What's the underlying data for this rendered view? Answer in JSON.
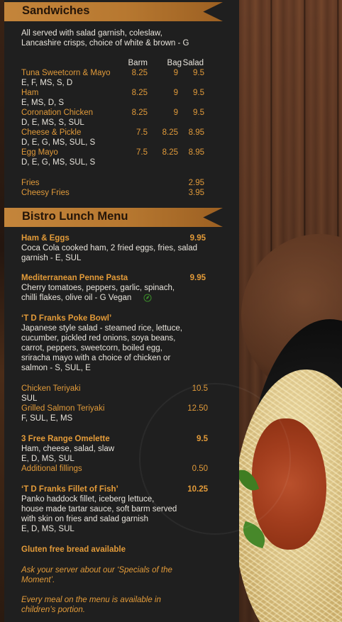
{
  "sandwiches": {
    "title": "Sandwiches",
    "intro": [
      "All served with salad garnish, coleslaw,",
      "Lancashire crisps, choice of white & brown - G"
    ],
    "columns": [
      "Barm",
      "Bag",
      "Salad"
    ],
    "items": [
      {
        "name": "Tuna Sweetcorn & Mayo",
        "barm": "8.25",
        "bag": "9",
        "salad": "9.5",
        "allergens": "E, F, MS, S, D"
      },
      {
        "name": "Ham",
        "barm": "8.25",
        "bag": "9",
        "salad": "9.5",
        "allergens": "E, MS, D, S"
      },
      {
        "name": "Coronation Chicken",
        "barm": "8.25",
        "bag": "9",
        "salad": "9.5",
        "allergens": "D, E, MS, S, SUL"
      },
      {
        "name": "Cheese & Pickle",
        "barm": "7.5",
        "bag": "8.25",
        "salad": "8.95",
        "allergens": "D, E, G, MS, SUL, S"
      },
      {
        "name": "Egg Mayo",
        "barm": "7.5",
        "bag": "8.25",
        "salad": "8.95",
        "allergens": "D, E, G, MS, SUL, S"
      }
    ],
    "sides": [
      {
        "name": "Fries",
        "price": "2.95"
      },
      {
        "name": "Cheesy Fries",
        "price": "3.95"
      }
    ]
  },
  "bistro": {
    "title": "Bistro Lunch Menu",
    "ham_eggs": {
      "name": "Ham & Eggs",
      "price": "9.95",
      "desc": [
        "Coca Cola cooked ham, 2 fried eggs, fries, salad",
        "garnish - E, SUL"
      ]
    },
    "penne": {
      "name": "Mediterranean Penne Pasta",
      "price": "9.95",
      "desc": [
        "Cherry tomatoes, peppers, garlic, spinach,",
        "chilli flakes, olive oil - G Vegan"
      ]
    },
    "poke": {
      "name": "‘T D Franks Poke Bowl’",
      "desc": [
        "Japanese style salad - steamed rice, lettuce,",
        "cucumber, pickled red onions, soya beans,",
        "carrot, peppers, sweetcorn, boiled egg,",
        "sriracha mayo with a choice of chicken or",
        "salmon - S, SUL, E"
      ]
    },
    "poke_options": [
      {
        "name": "Chicken Teriyaki",
        "price": "10.5",
        "allergens": "SUL"
      },
      {
        "name": "Grilled Salmon Teriyaki",
        "price": "12.50",
        "allergens": "F, SUL, E, MS"
      }
    ],
    "omelette": {
      "name": "3 Free Range Omelette",
      "price": "9.5",
      "desc": [
        "Ham, cheese, salad, slaw",
        "E, D, MS, SUL"
      ],
      "extra_name": "Additional fillings",
      "extra_price": "0.50"
    },
    "fish": {
      "name": "‘T D Franks Fillet of Fish’",
      "price": "10.25",
      "desc": [
        "Panko haddock fillet, iceberg lettuce,",
        "house made tartar sauce, soft barm served",
        "with skin on fries and salad garnish",
        "E, D, MS, SUL"
      ]
    },
    "gluten_note": "Gluten free bread available",
    "specials_note": [
      "Ask your server about our ‘Specials of the",
      "Moment’."
    ],
    "children_note": [
      "Every meal on the menu is available in",
      "children’s portion."
    ]
  },
  "colors": {
    "accent": "#e39b39",
    "banner": "#c4853b",
    "panel": "#1f1f1f",
    "text": "#e8e4dc"
  },
  "icons": {
    "vegan": "leaf-icon"
  }
}
